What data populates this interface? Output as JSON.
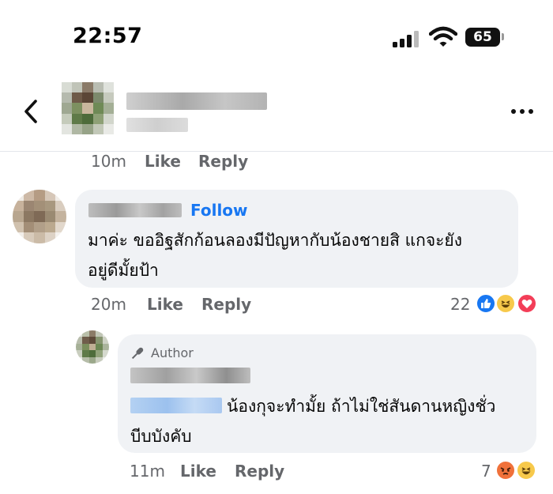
{
  "status_bar": {
    "time": "22:57",
    "battery": "65"
  },
  "header": {
    "back_icon": "chevron-left-icon",
    "more_icon": "more-horizontal-icon"
  },
  "prev_comment": {
    "time": "10m",
    "like": "Like",
    "reply": "Reply"
  },
  "comment1": {
    "follow": "Follow",
    "text_line1": "มาค่ะ ขออิฐสักก้อนลองมีปัญหากับน้องชายสิ แกจะยัง",
    "text_line2": "อยู่ดีมั้ยป้า",
    "time": "20m",
    "like": "Like",
    "reply": "Reply",
    "reaction_count": "22",
    "reactions": [
      "like-reaction-icon",
      "haha-reaction-icon",
      "love-reaction-icon"
    ]
  },
  "reply1": {
    "author_label": "Author",
    "text_line1": "น้องกุจะทำมั้ย ถ้าไม่ใช่สันดานหญิงชั่ว",
    "text_line2": "บีบบังคับ",
    "time": "11m",
    "like": "Like",
    "reply": "Reply",
    "reaction_count": "7",
    "reactions": [
      "angry-reaction-icon",
      "haha-reaction-icon"
    ]
  },
  "colors": {
    "link_blue": "#1877f2",
    "meta_gray": "#65676b",
    "bubble_bg": "#f0f2f5"
  }
}
